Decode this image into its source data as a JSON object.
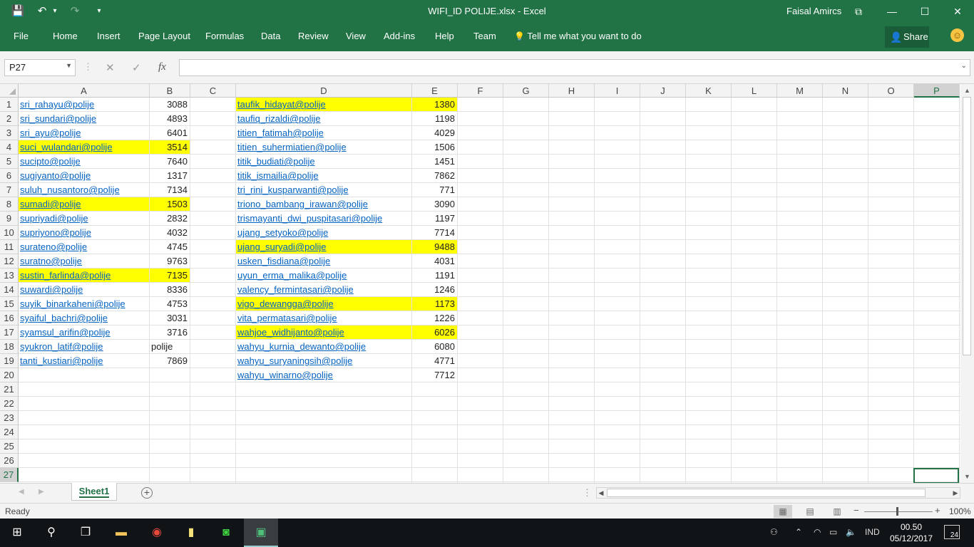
{
  "window": {
    "title": "WIFI_ID POLIJE.xlsx  -  Excel",
    "user": "Faisal Amircs",
    "buttons": {
      "display_options": "⧉",
      "minimize": "—",
      "maximize": "☐",
      "close": "✕"
    }
  },
  "quick_access": {
    "save": "💾",
    "undo": "↶",
    "undo_dd": "▾",
    "redo": "↷",
    "customize": "▾"
  },
  "ribbon": {
    "tabs": [
      "File",
      "Home",
      "Insert",
      "Page Layout",
      "Formulas",
      "Data",
      "Review",
      "View",
      "Add-ins",
      "Help",
      "Team"
    ],
    "tell_me": "Tell me what you want to do",
    "tell_me_icon": "💡",
    "share": "Share",
    "share_icon": "👤",
    "smiley": "☺"
  },
  "formula_bar": {
    "name_box": "P27",
    "cancel": "✕",
    "enter": "✓",
    "fx": "fx",
    "formula": ""
  },
  "sheet": {
    "columns": [
      "A",
      "B",
      "C",
      "D",
      "E",
      "F",
      "G",
      "H",
      "I",
      "J",
      "K",
      "L",
      "M",
      "N",
      "O",
      "P"
    ],
    "rows": [
      "1",
      "2",
      "3",
      "4",
      "5",
      "6",
      "7",
      "8",
      "9",
      "10",
      "11",
      "12",
      "13",
      "14",
      "15",
      "16",
      "17",
      "18",
      "19",
      "20",
      "21",
      "22",
      "23",
      "24",
      "25",
      "26",
      "27"
    ],
    "active_cell": "P27",
    "left_block": [
      {
        "email": "sri_rahayu@polije",
        "value": "3088",
        "highlight": false
      },
      {
        "email": "sri_sundari@polije",
        "value": "4893",
        "highlight": false
      },
      {
        "email": "sri_ayu@polije",
        "value": "6401",
        "highlight": false
      },
      {
        "email": "suci_wulandari@polije",
        "value": "3514",
        "highlight": true
      },
      {
        "email": "sucipto@polije",
        "value": "7640",
        "highlight": false
      },
      {
        "email": "sugiyanto@polije",
        "value": "1317",
        "highlight": false
      },
      {
        "email": "suluh_nusantoro@polije",
        "value": "7134",
        "highlight": false
      },
      {
        "email": "sumadi@polije",
        "value": "1503",
        "highlight": true
      },
      {
        "email": "supriyadi@polije",
        "value": "2832",
        "highlight": false
      },
      {
        "email": "supriyono@polije",
        "value": "4032",
        "highlight": false
      },
      {
        "email": "surateno@polije",
        "value": "4745",
        "highlight": false
      },
      {
        "email": "suratno@polije",
        "value": "9763",
        "highlight": false
      },
      {
        "email": "sustin_farlinda@polije",
        "value": "7135",
        "highlight": true
      },
      {
        "email": "suwardi@polije",
        "value": "8336",
        "highlight": false
      },
      {
        "email": "suyik_binarkaheni@polije",
        "value": "4753",
        "highlight": false
      },
      {
        "email": "syaiful_bachri@polije",
        "value": "3031",
        "highlight": false
      },
      {
        "email": "syamsul_arifin@polije",
        "value": "3716",
        "highlight": false
      },
      {
        "email": "syukron_latif@polije",
        "value": "polije",
        "highlight": false,
        "text": true
      },
      {
        "email": "tanti_kustiari@polije",
        "value": "7869",
        "highlight": false
      }
    ],
    "right_block": [
      {
        "email": "taufik_hidayat@polije",
        "value": "1380",
        "highlight": true
      },
      {
        "email": "taufiq_rizaldi@polije",
        "value": "1198",
        "highlight": false
      },
      {
        "email": "titien_fatimah@polije",
        "value": "4029",
        "highlight": false
      },
      {
        "email": "titien_suhermiatien@polije",
        "value": "1506",
        "highlight": false
      },
      {
        "email": "titik_budiati@polije",
        "value": "1451",
        "highlight": false
      },
      {
        "email": "titik_ismailia@polije",
        "value": "7862",
        "highlight": false
      },
      {
        "email": "tri_rini_kusparwanti@polije",
        "value": "771",
        "highlight": false
      },
      {
        "email": "triono_bambang_irawan@polije",
        "value": "3090",
        "highlight": false
      },
      {
        "email": "trismayanti_dwi_puspitasari@polije",
        "value": "1197",
        "highlight": false
      },
      {
        "email": "ujang_setyoko@polije",
        "value": "7714",
        "highlight": false
      },
      {
        "email": "ujang_suryadi@polije",
        "value": "9488",
        "highlight": true
      },
      {
        "email": "usken_fisdiana@polije",
        "value": "4031",
        "highlight": false
      },
      {
        "email": "uyun_erma_malika@polije",
        "value": "1191",
        "highlight": false
      },
      {
        "email": "valency_fermintasari@polije",
        "value": "1246",
        "highlight": false
      },
      {
        "email": "vigo_dewangga@polije",
        "value": "1173",
        "highlight": true
      },
      {
        "email": "vita_permatasari@polije",
        "value": "1226",
        "highlight": false
      },
      {
        "email": "wahjoe_widhijanto@polije",
        "value": "6026",
        "highlight": true
      },
      {
        "email": "wahyu_kurnia_dewanto@polije",
        "value": "6080",
        "highlight": false
      },
      {
        "email": "wahyu_suryaningsih@polije",
        "value": "4771",
        "highlight": false
      },
      {
        "email": "wahyu_winarno@polije",
        "value": "7712",
        "highlight": false
      }
    ]
  },
  "sheet_tabs": {
    "active": "Sheet1",
    "add": "+",
    "prev": "◀",
    "next": "▶"
  },
  "status_bar": {
    "status": "Ready",
    "zoom": "100%",
    "zoom_out": "−",
    "zoom_in": "+"
  },
  "taskbar": {
    "time": "00.50",
    "date": "05/12/2017",
    "language": "IND",
    "notifications": "24"
  },
  "colors": {
    "accent": "#217346",
    "highlight": "#ffff00",
    "link": "#0563c1"
  }
}
